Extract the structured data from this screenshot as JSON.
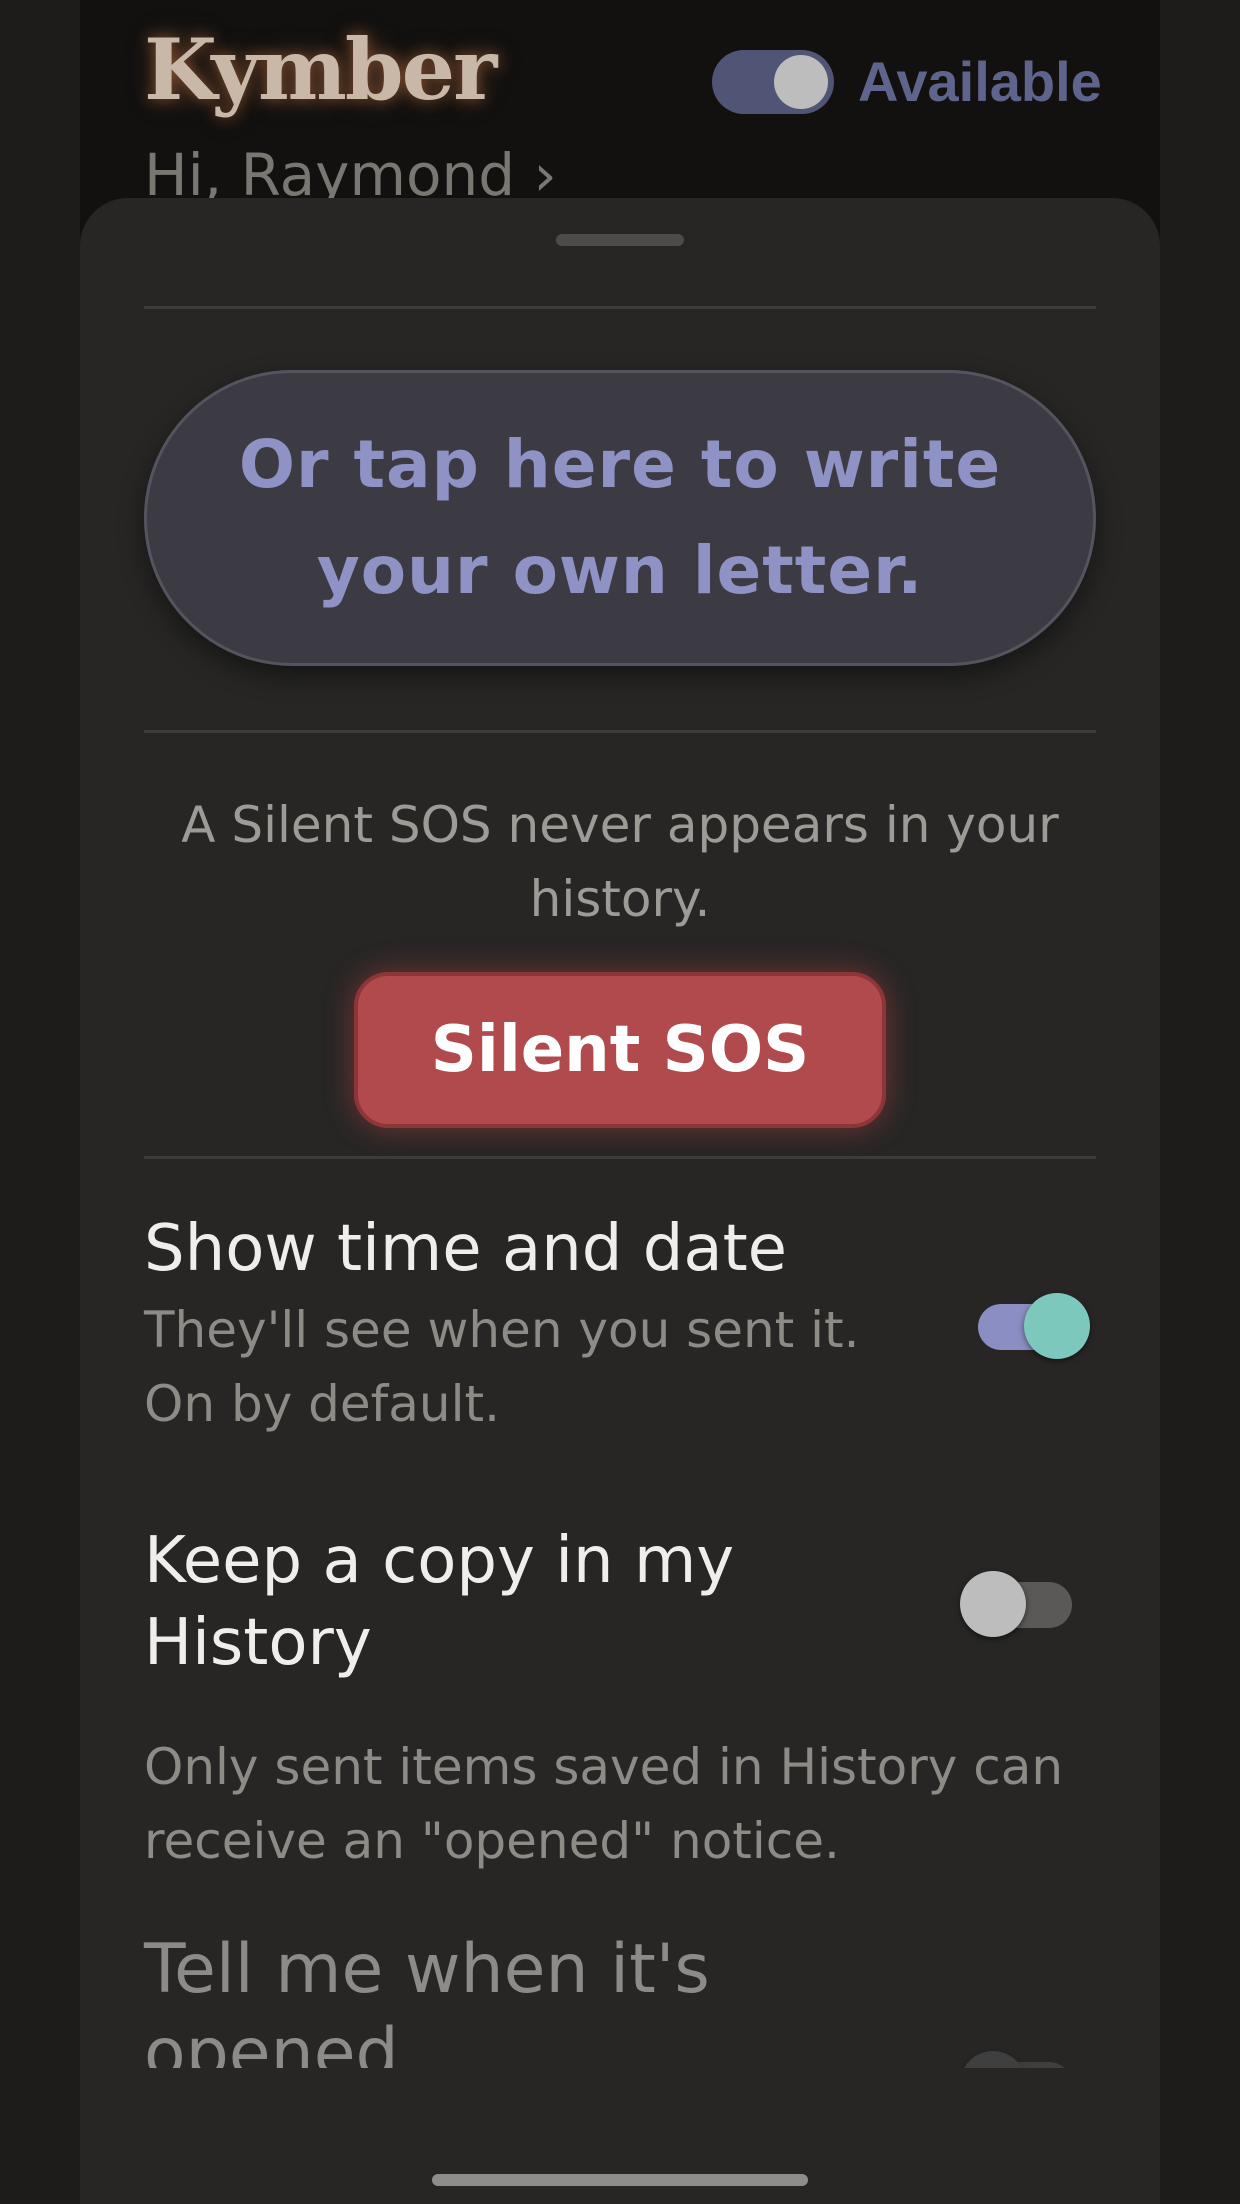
{
  "header": {
    "brand": "Kymber",
    "greeting": "Hi, Raymond ›",
    "availability": {
      "label": "Available",
      "on": true
    }
  },
  "compose": {
    "write_own_letter": "Or tap here to write your own letter."
  },
  "sos": {
    "note": "A Silent SOS never appears in your history.",
    "button_label": "Silent SOS",
    "button_color": "#b14a4c"
  },
  "options": {
    "show_time": {
      "title": "Show time and date",
      "description": "They'll see when you sent it. On by default.",
      "on": true
    },
    "keep_history": {
      "title": "Keep a copy in my History",
      "description": "Only sent items saved in History can receive an \"opened\" notice.",
      "on": false
    },
    "opened_notice": {
      "title": "Tell me when it's opened",
      "on": false
    }
  },
  "colors": {
    "accent": "#8f92c4",
    "toggle_on_knob": "#7cc8bc",
    "sheet_background": "#272625"
  }
}
